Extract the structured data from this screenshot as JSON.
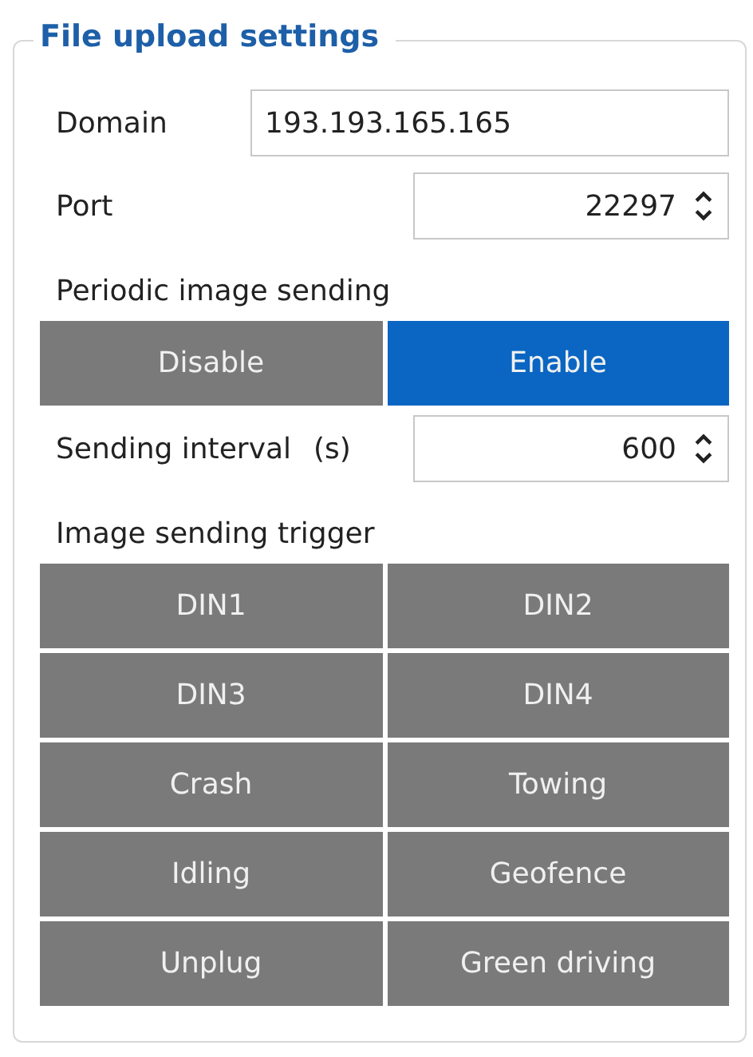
{
  "group": {
    "title": "File upload settings"
  },
  "fields": [
    {
      "label": "Domain",
      "value": "193.193.165.165",
      "kind": "text"
    },
    {
      "label": "Port",
      "value": "22297",
      "kind": "spin"
    }
  ],
  "periodic_sending": {
    "label": "Periodic image sending",
    "options": [
      {
        "label": "Disable",
        "selected": false
      },
      {
        "label": "Enable",
        "selected": true
      }
    ]
  },
  "interval": {
    "label": "Sending interval",
    "unit": "(s)",
    "value": "600"
  },
  "trigger": {
    "label": "Image sending trigger",
    "options": [
      {
        "label": "DIN1",
        "selected": false
      },
      {
        "label": "DIN2",
        "selected": false
      },
      {
        "label": "DIN3",
        "selected": false
      },
      {
        "label": "DIN4",
        "selected": false
      },
      {
        "label": "Crash",
        "selected": false
      },
      {
        "label": "Towing",
        "selected": false
      },
      {
        "label": "Idling",
        "selected": false
      },
      {
        "label": "Geofence",
        "selected": false
      },
      {
        "label": "Unplug",
        "selected": false
      },
      {
        "label": "Green driving",
        "selected": false
      }
    ]
  }
}
